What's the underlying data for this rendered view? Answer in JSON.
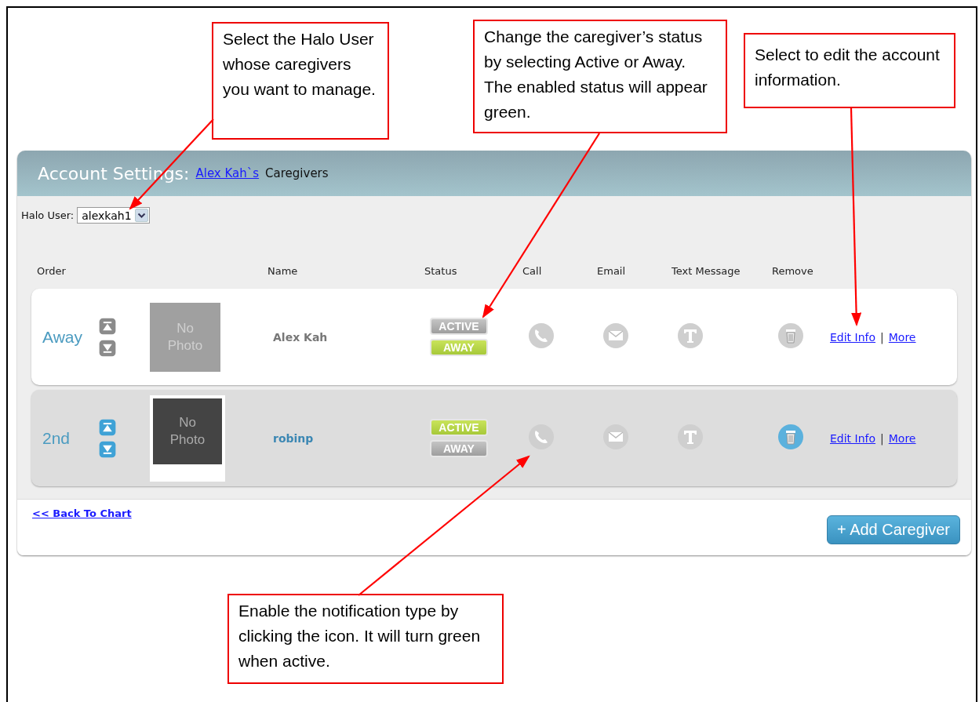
{
  "header": {
    "title": "Account Settings:",
    "user_link": "Alex Kah`s",
    "suffix": "Caregivers"
  },
  "halo_user": {
    "label": "Halo User:",
    "value": "alexkah1"
  },
  "columns": [
    "Order",
    "Name",
    "Status",
    "Call",
    "Email",
    "Text Message",
    "Remove"
  ],
  "rows": [
    {
      "order": "Away",
      "selected": false,
      "photo": "No Photo",
      "name": "Alex Kah",
      "status": [
        {
          "label": "ACTIVE",
          "selected": false
        },
        {
          "label": "AWAY",
          "selected": true
        }
      ],
      "notifications": [
        {
          "kind": "call",
          "on": false
        },
        {
          "kind": "email",
          "on": false
        },
        {
          "kind": "text",
          "on": false
        }
      ],
      "links": [
        "Edit Info",
        "More"
      ],
      "separator": "|"
    },
    {
      "order": "2nd",
      "selected": true,
      "photo": "No Photo",
      "name": "robinp",
      "status": [
        {
          "label": "ACTIVE",
          "selected": true
        },
        {
          "label": "AWAY",
          "selected": false
        }
      ],
      "notifications": [
        {
          "kind": "call",
          "on": false
        },
        {
          "kind": "email",
          "on": false
        },
        {
          "kind": "text",
          "on": false
        }
      ],
      "links": [
        "Edit Info",
        "More"
      ],
      "separator": "|"
    }
  ],
  "back_link": "<< Back To Chart",
  "add_button": "+ Add Caregiver",
  "callouts": [
    {
      "text": "Select the Halo User whose caregivers you want to manage."
    },
    {
      "text": "Change the caregiver’s status by selecting Active or Away. The enabled status will appear green."
    },
    {
      "text": "Select to edit the account information."
    },
    {
      "text": "Enable the notification type by clicking the icon. It will turn green when active."
    }
  ]
}
